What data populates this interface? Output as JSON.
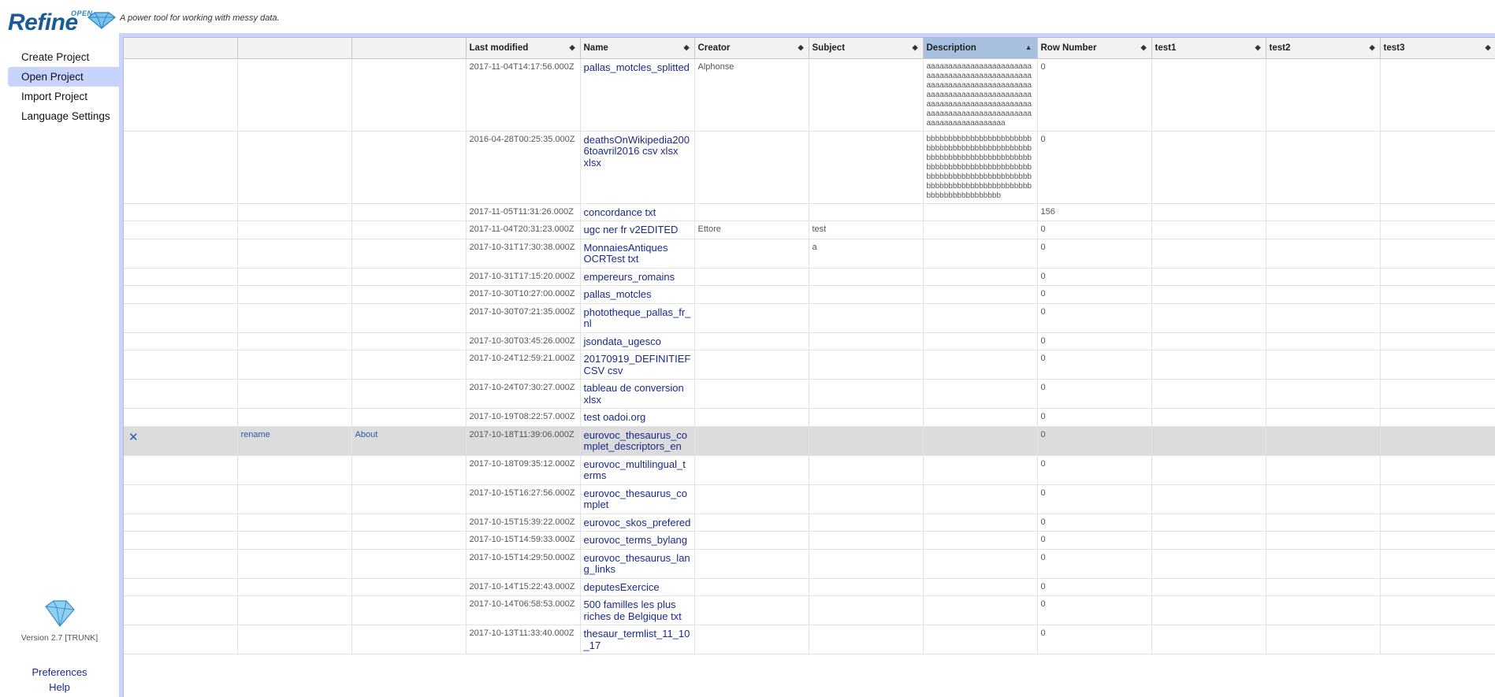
{
  "header": {
    "logo_open": "OPEN",
    "logo_refine": "Refine",
    "tagline": "A power tool for working with messy data."
  },
  "nav": {
    "items": [
      {
        "label": "Create Project",
        "selected": false
      },
      {
        "label": "Open Project",
        "selected": true
      },
      {
        "label": "Import Project",
        "selected": false
      },
      {
        "label": "Language Settings",
        "selected": false
      }
    ]
  },
  "footer": {
    "version": "Version 2.7 [TRUNK]",
    "preferences": "Preferences",
    "help": "Help"
  },
  "table": {
    "columns": [
      "",
      "",
      "",
      "Last modified",
      "Name",
      "Creator",
      "Subject",
      "Description",
      "Row Number",
      "test1",
      "test2",
      "test3"
    ],
    "sorted_column": "Description",
    "row_actions": {
      "delete": "✕",
      "rename": "rename",
      "about": "About"
    },
    "rows": [
      {
        "modified": "2017-11-04T14:17:56.000Z",
        "name": "pallas_motcles_splitted",
        "creator": "Alphonse",
        "subject": "",
        "description": "aaaaaaaaaaaaaaaaaaaaaaaaaaaaaaaaaaaaaaaaaaaaaaaaaaaaaaaaaaaaaaaaaaaaaaaaaaaaaaaaaaaaaaaaaaaaaaaaaaaaaaaaaaaaaaaaaaaaaaaaaaaaaaaaaaaaaaaaaaaaaaaaaaaaaaaaaaaaaaaaaa",
        "rows": "0"
      },
      {
        "modified": "2016-04-28T00:25:35.000Z",
        "name": "deathsOnWikipedia2006toavril2016 csv xlsx xlsx",
        "creator": "",
        "subject": "",
        "description": "bbbbbbbbbbbbbbbbbbbbbbbbbbbbbbbbbbbbbbbbbbbbbbbbbbbbbbbbbbbbbbbbbbbbbbbbbbbbbbbbbbbbbbbbbbbbbbbbbbbbbbbbbbbbbbbbbbbbbbbbbbbbbbbbbbbbbbbbbbbbbbbbbbbbbbbbbbbbbbbbb",
        "rows": "0"
      },
      {
        "modified": "2017-11-05T11:31:26.000Z",
        "name": "concordance txt",
        "creator": "",
        "subject": "",
        "description": "",
        "rows": "156"
      },
      {
        "modified": "2017-11-04T20:31:23.000Z",
        "name": "ugc ner fr v2EDITED",
        "creator": "Ettore",
        "subject": "test",
        "description": "",
        "rows": "0"
      },
      {
        "modified": "2017-10-31T17:30:38.000Z",
        "name": "MonnaiesAntiques OCRTest txt",
        "creator": "",
        "subject": "a",
        "description": "",
        "rows": "0"
      },
      {
        "modified": "2017-10-31T17:15:20.000Z",
        "name": "empereurs_romains",
        "creator": "",
        "subject": "",
        "description": "",
        "rows": "0"
      },
      {
        "modified": "2017-10-30T10:27:00.000Z",
        "name": "pallas_motcles",
        "creator": "",
        "subject": "",
        "description": "",
        "rows": "0"
      },
      {
        "modified": "2017-10-30T07:21:35.000Z",
        "name": "phototheque_pallas_fr_nl",
        "creator": "",
        "subject": "",
        "description": "",
        "rows": "0"
      },
      {
        "modified": "2017-10-30T03:45:26.000Z",
        "name": "jsondata_ugesco",
        "creator": "",
        "subject": "",
        "description": "",
        "rows": "0"
      },
      {
        "modified": "2017-10-24T12:59:21.000Z",
        "name": "20170919_DEFINITIEF CSV csv",
        "creator": "",
        "subject": "",
        "description": "",
        "rows": "0"
      },
      {
        "modified": "2017-10-24T07:30:27.000Z",
        "name": "tableau de conversion xlsx",
        "creator": "",
        "subject": "",
        "description": "",
        "rows": "0"
      },
      {
        "modified": "2017-10-19T08:22:57.000Z",
        "name": "test oadoi.org",
        "creator": "",
        "subject": "",
        "description": "",
        "rows": "0"
      },
      {
        "modified": "2017-10-18T11:39:06.000Z",
        "name": "eurovoc_thesaurus_complet_descriptors_en",
        "creator": "",
        "subject": "",
        "description": "",
        "rows": "0",
        "hovered": true
      },
      {
        "modified": "2017-10-18T09:35:12.000Z",
        "name": "eurovoc_multilingual_terms",
        "creator": "",
        "subject": "",
        "description": "",
        "rows": "0"
      },
      {
        "modified": "2017-10-15T16:27:56.000Z",
        "name": "eurovoc_thesaurus_complet",
        "creator": "",
        "subject": "",
        "description": "",
        "rows": "0"
      },
      {
        "modified": "2017-10-15T15:39:22.000Z",
        "name": "eurovoc_skos_prefered",
        "creator": "",
        "subject": "",
        "description": "",
        "rows": "0"
      },
      {
        "modified": "2017-10-15T14:59:33.000Z",
        "name": "eurovoc_terms_bylang",
        "creator": "",
        "subject": "",
        "description": "",
        "rows": "0"
      },
      {
        "modified": "2017-10-15T14:29:50.000Z",
        "name": "eurovoc_thesaurus_lang_links",
        "creator": "",
        "subject": "",
        "description": "",
        "rows": "0"
      },
      {
        "modified": "2017-10-14T15:22:43.000Z",
        "name": "deputesExercice",
        "creator": "",
        "subject": "",
        "description": "",
        "rows": "0"
      },
      {
        "modified": "2017-10-14T06:58:53.000Z",
        "name": "500 familles les plus riches de Belgique txt",
        "creator": "",
        "subject": "",
        "description": "",
        "rows": "0"
      },
      {
        "modified": "2017-10-13T11:33:40.000Z",
        "name": "thesaur_termlist_11_10_17",
        "creator": "",
        "subject": "",
        "description": "",
        "rows": "0"
      }
    ]
  }
}
